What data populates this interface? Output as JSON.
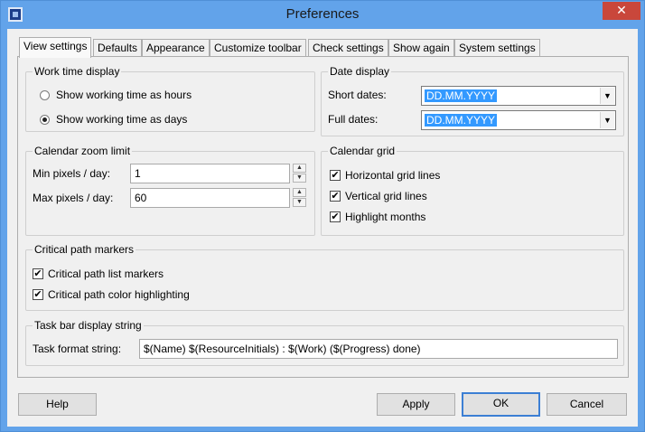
{
  "window": {
    "title": "Preferences",
    "close_glyph": "✕"
  },
  "tabs": [
    {
      "label": "View settings"
    },
    {
      "label": "Defaults"
    },
    {
      "label": "Appearance"
    },
    {
      "label": "Customize toolbar"
    },
    {
      "label": "Check settings"
    },
    {
      "label": "Show again"
    },
    {
      "label": "System settings"
    }
  ],
  "work_time": {
    "title": "Work time display",
    "options": [
      {
        "label": "Show working time as hours",
        "checked": false
      },
      {
        "label": "Show working time as days",
        "checked": true
      }
    ]
  },
  "date_display": {
    "title": "Date display",
    "short_label": "Short dates:",
    "short_value": "DD.MM.YYYY",
    "full_label": "Full dates:",
    "full_value": "DD.MM.YYYY"
  },
  "zoom": {
    "title": "Calendar zoom limit",
    "min_label": "Min pixels / day:",
    "min_value": "1",
    "max_label": "Max pixels / day:",
    "max_value": "60"
  },
  "grid": {
    "title": "Calendar grid",
    "items": [
      {
        "label": "Horizontal grid lines",
        "checked": true
      },
      {
        "label": "Vertical grid lines",
        "checked": true
      },
      {
        "label": "Highlight months",
        "checked": true
      }
    ]
  },
  "critical": {
    "title": "Critical path markers",
    "items": [
      {
        "label": "Critical path list markers",
        "checked": true
      },
      {
        "label": "Critical path color highlighting",
        "checked": true
      }
    ]
  },
  "taskbar": {
    "title": "Task bar display string",
    "label": "Task format string:",
    "value": "$(Name) $(ResourceInitials) : $(Work) ($(Progress) done)"
  },
  "buttons": {
    "help": "Help",
    "apply": "Apply",
    "ok": "OK",
    "cancel": "Cancel"
  },
  "glyphs": {
    "check": "✔",
    "up": "▲",
    "down": "▼"
  }
}
